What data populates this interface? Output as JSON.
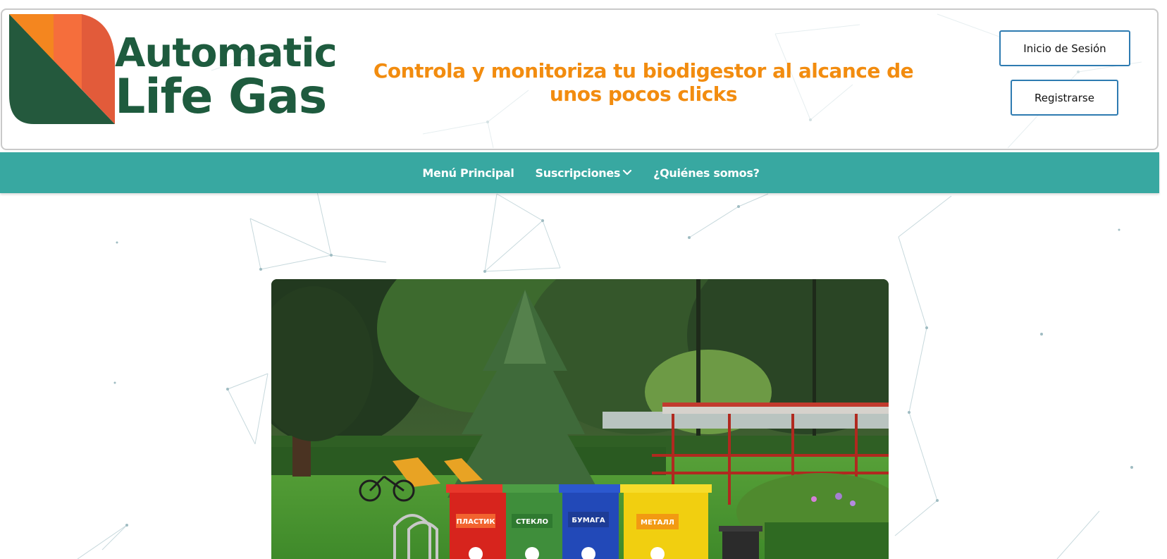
{
  "brand": {
    "name_line1": "Automatic",
    "name_line2": "Life Gas",
    "tagline": "Controla y monitoriza tu biodigestor al alcance de unos pocos clicks"
  },
  "auth": {
    "login_label": "Inicio de Sesión",
    "register_label": "Registrarse"
  },
  "nav": {
    "items": [
      {
        "label": "Menú Principal"
      },
      {
        "label": "Suscripciones"
      },
      {
        "label": "¿Quiénes somos?"
      }
    ]
  },
  "hero": {
    "bins": [
      {
        "label": "ПЛАСТИК",
        "color": "#e12a22"
      },
      {
        "label": "СТЕКЛО",
        "color": "#3f8e3b"
      },
      {
        "label": "БУМАГА",
        "color": "#2249b8"
      },
      {
        "label": "МЕТАЛЛ",
        "color": "#f3d10f"
      }
    ]
  },
  "colors": {
    "brand_green": "#1e5b3e",
    "accent_orange": "#f28c0f",
    "nav_teal": "#38a8a1",
    "button_border": "#2e7bb1"
  }
}
